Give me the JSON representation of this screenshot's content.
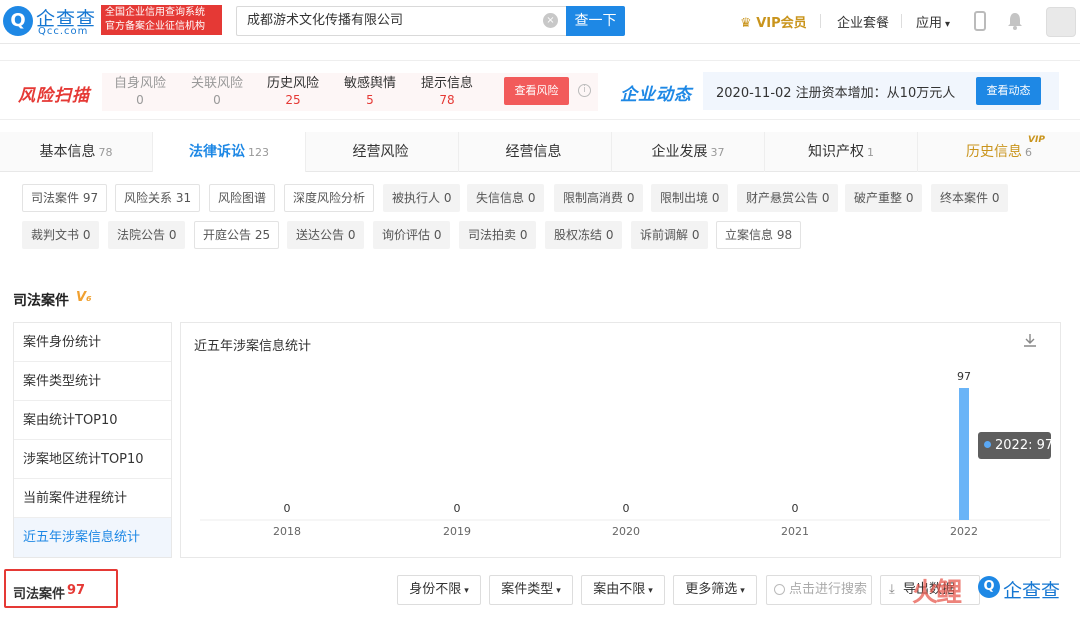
{
  "header": {
    "logo_glyph": "Q",
    "logo_cn": "企查查",
    "logo_en": "Qcc.com",
    "tag_line1": "全国企业信用查询系统",
    "tag_line2": "官方备案企业征信机构",
    "search_value": "成都游术文化传播有限公司",
    "clear_glyph": "×",
    "search_button": "查一下",
    "vip_label": "VIP会员",
    "package_label": "企业套餐",
    "apps_label": "应用",
    "apps_caret": "▾",
    "bell_glyph": "🔔"
  },
  "risk_scan": {
    "title": "风险扫描",
    "items": [
      {
        "label": "自身风险",
        "value": "0",
        "color": "#999999"
      },
      {
        "label": "关联风险",
        "value": "0",
        "color": "#999999"
      },
      {
        "label": "历史风险",
        "value": "25",
        "color": "#e53935"
      },
      {
        "label": "敏感舆情",
        "value": "5",
        "color": "#e53935"
      },
      {
        "label": "提示信息",
        "value": "78",
        "color": "#e53935"
      }
    ],
    "view_button": "查看风险",
    "info_glyph": "i"
  },
  "dynamics": {
    "title": "企业动态",
    "text": "2020-11-02 注册资本增加：从10万元人...",
    "view_button": "查看动态"
  },
  "tabs": [
    {
      "label": "基本信息",
      "count": "78"
    },
    {
      "label": "法律诉讼",
      "count": "123"
    },
    {
      "label": "经营风险",
      "count": ""
    },
    {
      "label": "经营信息",
      "count": ""
    },
    {
      "label": "企业发展",
      "count": "37"
    },
    {
      "label": "知识产权",
      "count": "1"
    },
    {
      "label": "历史信息",
      "count": "6"
    }
  ],
  "vip_mini": "VIP",
  "chips_row1": [
    "司法案件 97",
    "风险关系 31",
    "风险图谱",
    "深度风险分析",
    "被执行人 0",
    "失信信息 0",
    "限制高消费 0",
    "限制出境 0",
    "财产悬赏公告 0",
    "破产重整 0",
    "终本案件 0"
  ],
  "chips_row2": [
    "裁判文书 0",
    "法院公告 0",
    "开庭公告 25",
    "送达公告 0",
    "询价评估 0",
    "司法拍卖 0",
    "股权冻结 0",
    "诉前调解 0",
    "立案信息 98"
  ],
  "section": {
    "title": "司法案件",
    "badge": "V₆"
  },
  "side_menu": [
    "案件身份统计",
    "案件类型统计",
    "案由统计TOP10",
    "涉案地区统计TOP10",
    "当前案件进程统计",
    "近五年涉案信息统计"
  ],
  "chart_panel_title": "近五年涉案信息统计",
  "download_glyph": "⤓",
  "chart_data": {
    "type": "bar",
    "categories": [
      "2018",
      "2019",
      "2020",
      "2021",
      "2022"
    ],
    "values": [
      0,
      0,
      0,
      0,
      97
    ],
    "bar_color": "#6ab4f7",
    "tooltip": "2022: 97"
  },
  "bottom": {
    "case_label": "司法案件",
    "case_count": "97",
    "filters": [
      "身份不限",
      "案件类型",
      "案由不限",
      "更多筛选"
    ],
    "caret": "▾",
    "search_placeholder": "点击进行搜索",
    "export_label": "导出数据",
    "export_glyph": "⤓",
    "watermark_logo": "Q",
    "watermark_text": "企查查",
    "watermark_red": "火鲤"
  }
}
